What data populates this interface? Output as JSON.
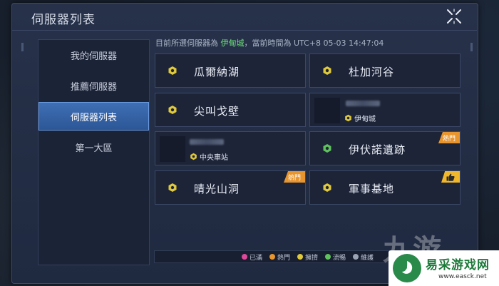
{
  "header": {
    "title": "伺服器列表"
  },
  "sidebar": {
    "items": [
      {
        "label": "我的伺服器",
        "active": false
      },
      {
        "label": "推薦伺服器",
        "active": false
      },
      {
        "label": "伺服器列表",
        "active": true
      },
      {
        "label": "第一大區",
        "active": false
      }
    ]
  },
  "status": {
    "prefix": "目前所選伺服器為",
    "city": "伊甸城",
    "time_text": "，當前時間為 UTC+8 05-03 14:47:04"
  },
  "servers": [
    {
      "name": "瓜爾納湖"
    },
    {
      "name": "杜加河谷"
    },
    {
      "name": "尖叫戈壁"
    },
    {
      "location": "伊甸城"
    },
    {
      "location": "中央車站"
    },
    {
      "name": "伊伏諾遺跡",
      "badge": "熱門"
    },
    {
      "name": "晴光山洞",
      "badge": "熱門"
    },
    {
      "name": "軍事基地"
    }
  ],
  "legend": [
    {
      "label": "已滿",
      "color": "#e0489a"
    },
    {
      "label": "熱門",
      "color": "#e8952e"
    },
    {
      "label": "擁擠",
      "color": "#e0c93a"
    },
    {
      "label": "流暢",
      "color": "#5fc25c"
    },
    {
      "label": "維護",
      "color": "#9aa3b4"
    }
  ],
  "colors": {
    "smooth": "#5fc25c",
    "crowded": "#e0c93a",
    "hot": "#e8952e",
    "accent": "#3f6fb5"
  },
  "watermark": {
    "text": "九游"
  },
  "logo": {
    "text": "易采游戏网",
    "url": "www.easck.net"
  }
}
